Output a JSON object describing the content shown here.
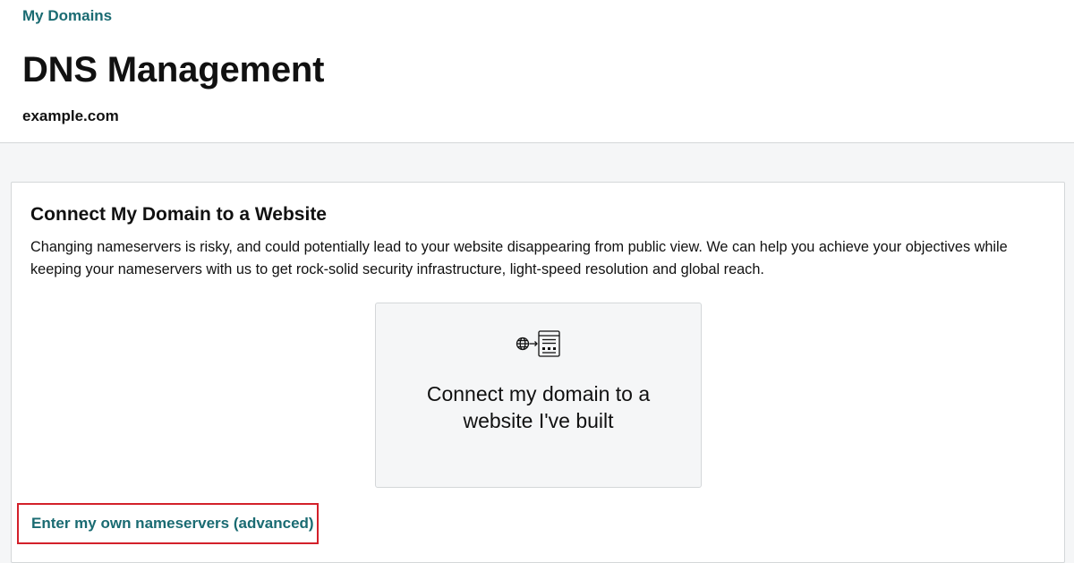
{
  "header": {
    "breadcrumb": "My Domains",
    "title": "DNS Management",
    "domain": "example.com"
  },
  "card": {
    "title": "Connect My Domain to a Website",
    "description": "Changing nameservers is risky, and could potentially lead to your website disappearing from public view. We can help you achieve your objectives while keeping your nameservers with us to get rock-solid security infrastructure, light-speed resolution and global reach.",
    "option": {
      "icon": "globe-to-website-icon",
      "line1": "Connect my domain to a",
      "line2": "website I've built"
    },
    "advanced_link": "Enter my own nameservers (advanced)"
  },
  "colors": {
    "link": "#1a6b72",
    "highlight_border": "#d3202a",
    "page_background": "#f5f6f7"
  }
}
